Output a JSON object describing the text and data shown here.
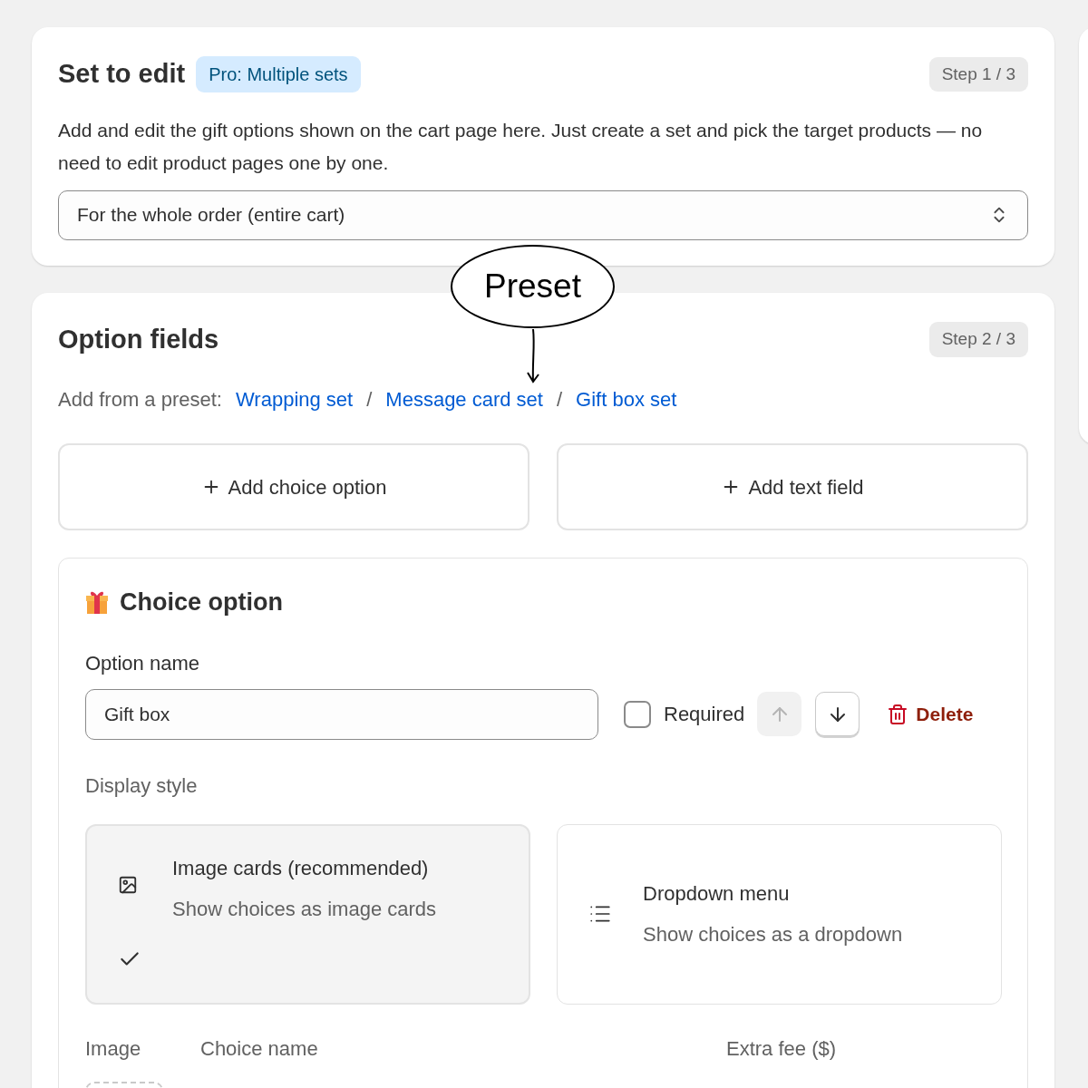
{
  "set_card": {
    "title": "Set to edit",
    "badge": "Pro: Multiple sets",
    "step": "Step 1 / 3",
    "description": "Add and edit the gift options shown on the cart page here. Just create a set and pick the target products — no need to edit product pages one by one.",
    "select_value": "For the whole order (entire cart)"
  },
  "annotation": {
    "text": "Preset"
  },
  "fields_card": {
    "title": "Option fields",
    "step": "Step 2 / 3",
    "preset_label": "Add from a preset:",
    "presets": [
      {
        "label": "Wrapping set",
        "separator": "/"
      },
      {
        "label": "Message card set",
        "separator": "/"
      },
      {
        "label": "Gift box set"
      }
    ],
    "add_buttons": [
      {
        "label": "Add choice option"
      },
      {
        "label": "Add text field"
      }
    ],
    "choice_option": {
      "title": "Choice option",
      "name_label": "Option name",
      "name_value": "Gift box",
      "required_label": "Required",
      "required_checked": false,
      "move_up_disabled": true,
      "move_down_disabled": false,
      "delete_label": "Delete",
      "display_label": "Display style",
      "styles": [
        {
          "kind": "image",
          "title": "Image cards (recommended)",
          "description": "Show choices as image cards",
          "selected": true
        },
        {
          "kind": "list",
          "title": "Dropdown menu",
          "description": "Show choices as a dropdown",
          "selected": false
        }
      ],
      "columns": [
        "Image",
        "Choice name",
        "Extra fee ($)"
      ]
    }
  }
}
